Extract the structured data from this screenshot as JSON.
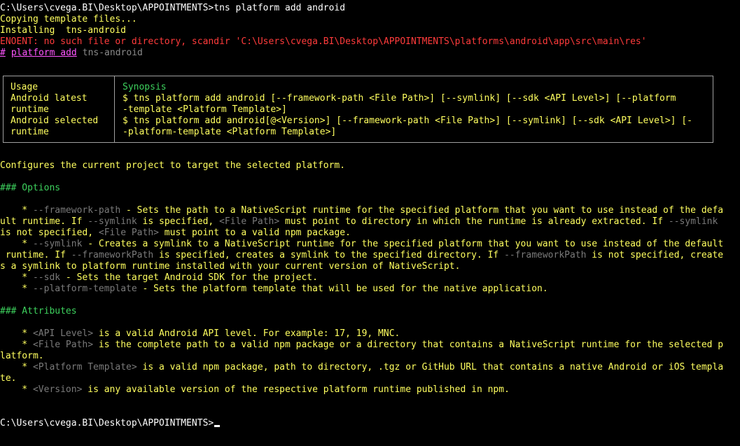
{
  "terminal": {
    "cmd_line": "C:\\Users\\cvega.BI\\Desktop\\APPOINTMENTS>tns platform add android",
    "copying": "Copying template files...",
    "installing": "Installing  tns-android",
    "error": "ENOENT: no such file or directory, scandir 'C:\\Users\\cvega.BI\\Desktop\\APPOINTMENTS\\platforms\\android\\app\\src\\main\\res'",
    "help_hash": "#",
    "help_link": "platform add",
    "help_pkg": "tns-android",
    "usage_table": {
      "col1_header": "Usage",
      "col2_header": "Synopsis",
      "row1_label_a": "Android latest",
      "row1_label_b": "runtime",
      "row1_syn_a": "$ tns platform add android [--framework-path <File Path>] [--symlink] [--sdk <API Level>] [--platform",
      "row1_syn_b": "-template <Platform Template>]",
      "row2_label_a": "Android selected",
      "row2_label_b": "runtime",
      "row2_syn_a": "$ tns platform add android[@<Version>] [--framework-path <File Path>] [--symlink] [--sdk <API Level>] [-",
      "row2_syn_b": "-platform-template <Platform Template>]"
    },
    "description": "Configures the current project to target the selected platform.",
    "options_heading": "### Options",
    "opt_framework": {
      "bullet": "    * ",
      "flag": "--framework-path",
      "t1": " - Sets the path to a NativeScript runtime for the specified platform that you want to use instead of the defa",
      "l2a": "ult runtime. If ",
      "l2flag": "--symlink",
      "l2b": " is specified, ",
      "l2ph": "<File Path>",
      "l2c": " must point to directory in which the runtime is already extracted. If ",
      "l2flag2": "--symlink",
      "l3a": "is not specified, ",
      "l3ph": "<File Path>",
      "l3b": " must point to a valid npm package."
    },
    "opt_symlink": {
      "bullet": "    * ",
      "flag": "--symlink",
      "t1": " - Creates a symlink to a NativeScript runtime for the specified platform that you want to use instead of the default",
      "l2a": " runtime. If ",
      "l2flag": "--frameworkPath",
      "l2b": " is specified, creates a symlink to the specified directory. If ",
      "l2flag2": "--frameworkPath",
      "l2c": " is not specified, create",
      "l3": "s a symlink to platform runtime installed with your current version of NativeScript."
    },
    "opt_sdk": {
      "bullet": "    * ",
      "flag": "--sdk",
      "text": " - Sets the target Android SDK for the project."
    },
    "opt_template": {
      "bullet": "    * ",
      "flag": "--platform-template",
      "text": " - Sets the platform template that will be used for the native application."
    },
    "attributes_heading": "### Attributes",
    "attr_api": {
      "bullet": "    * ",
      "ph": "<API Level>",
      "text": " is a valid Android API level. For example: 17, 19, MNC."
    },
    "attr_file": {
      "bullet": "    * ",
      "ph": "<File Path>",
      "text": " is the complete path to a valid npm package or a directory that contains a NativeScript runtime for the selected p",
      "l2": "latform."
    },
    "attr_template": {
      "bullet": "    * ",
      "ph": "<Platform Template>",
      "text": " is a valid npm package, path to directory, .tgz or GitHub URL that contains a native Android or iOS templa",
      "l2": "te."
    },
    "attr_version": {
      "bullet": "    * ",
      "ph": "<Version>",
      "text": " is any available version of the respective platform runtime published in npm."
    },
    "prompt": "C:\\Users\\cvega.BI\\Desktop\\APPOINTMENTS>"
  },
  "colors": {
    "background": "#000000",
    "command": "#ffffff",
    "body": "#ffff5f",
    "error": "#ff3b3b",
    "help_link": "#ff55ff",
    "flag": "#7a7a7a",
    "heading": "#3dd15d"
  }
}
